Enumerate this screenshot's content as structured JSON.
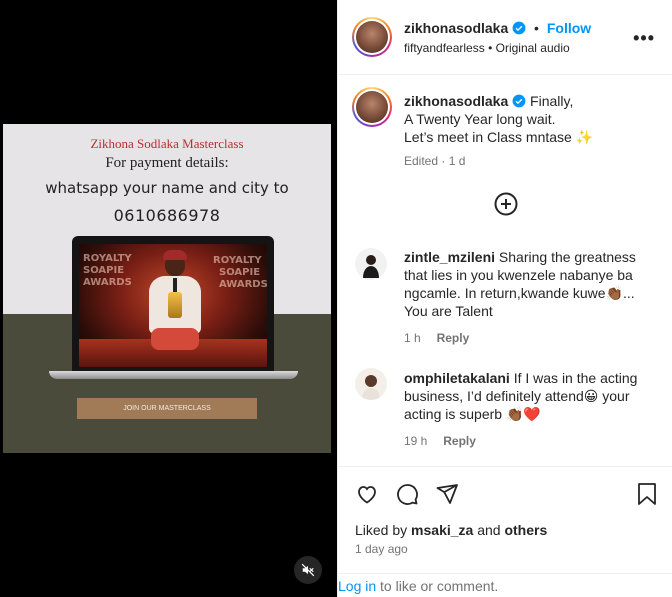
{
  "media": {
    "poster": {
      "title": "Zikhona Sodlaka Masterclass",
      "payment_line": "For payment details:",
      "whatsapp_line": "whatsapp your name and city to",
      "phone": "0610686978",
      "button_label": "JOIN OUR MASTERCLASS"
    },
    "award_text": [
      "ROYALTY",
      "SOAPIE",
      "AWARDS"
    ],
    "mute_icon": "speaker-muted-icon"
  },
  "post": {
    "author": "zikhonasodlaka",
    "follow_label": "Follow",
    "audio_user": "fiftyandfearless",
    "audio_label": "Original audio",
    "more_label": "•••"
  },
  "caption": {
    "author": "zikhonasodlaka",
    "lines": [
      "Finally,",
      "A Twenty Year long wait.",
      "Let’s meet in Class mntase ✨"
    ],
    "meta": "Edited · 1 d"
  },
  "comments": [
    {
      "user": "zintle_mzileni",
      "text_lines": [
        "Sharing the greatness",
        "that lies in you kwenzele nabanye ba",
        "ngcamle. In return,kwande kuwe👏🏾...",
        "You are Talent"
      ],
      "time": "1 h",
      "reply_label": "Reply"
    },
    {
      "user": "omphiletakalani",
      "text_lines": [
        "If I was in the acting",
        "business, I’d definitely attend😀 your",
        "acting is superb 👏🏾❤️"
      ],
      "time": "19 h",
      "reply_label": "Reply"
    }
  ],
  "footer": {
    "liked_prefix": "Liked by",
    "liked_user": "msaki_za",
    "liked_and": "and",
    "liked_others": "others",
    "date": "1 day ago",
    "login_link": "Log in",
    "login_rest": " to like or comment."
  },
  "colors": {
    "link_blue": "#0095f6",
    "poster_title_red": "#b6312f",
    "poster_button": "#a17b58",
    "poster_dark": "#4a4b3b"
  }
}
